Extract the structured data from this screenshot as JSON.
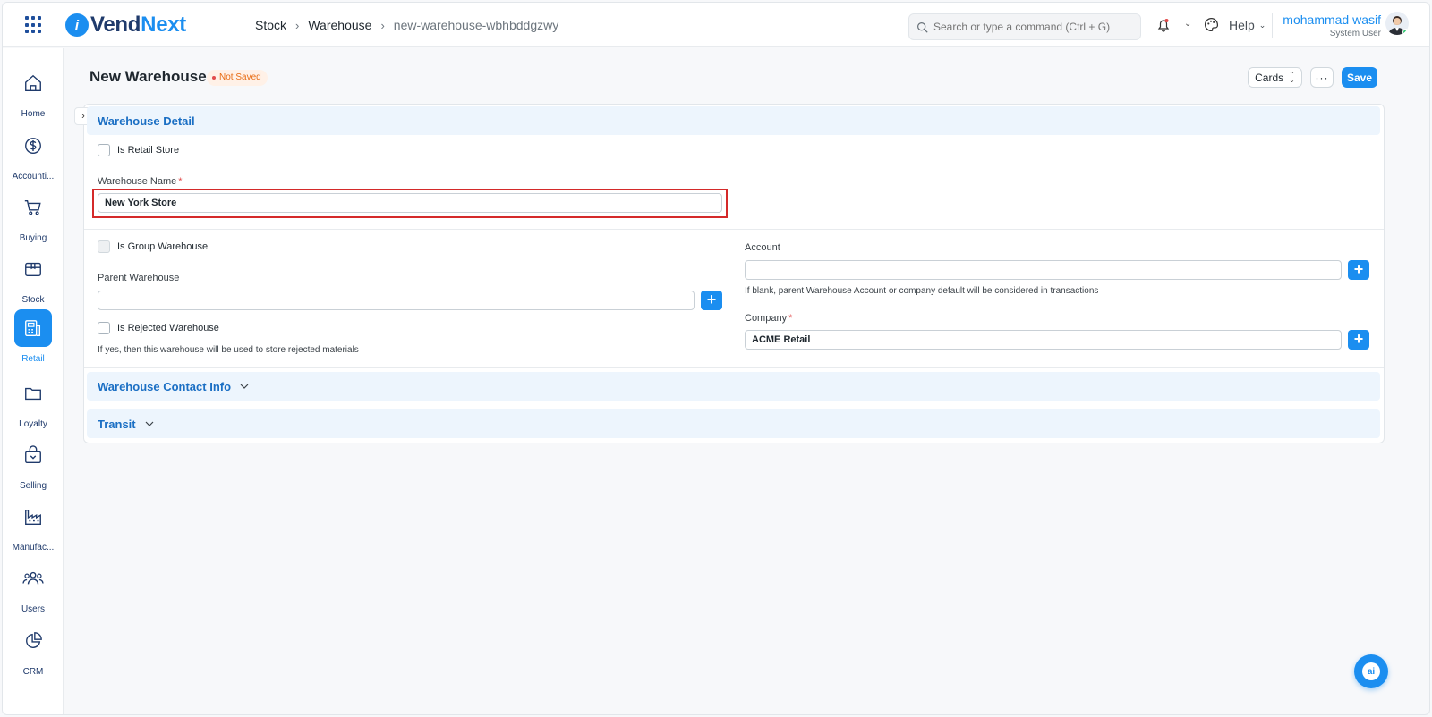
{
  "app": {
    "logo_prefix": "i",
    "logo_brand_a": "Vend",
    "logo_brand_b": "Next"
  },
  "breadcrumb": {
    "items": [
      "Stock",
      "Warehouse",
      "new-warehouse-wbhbddgzwy"
    ]
  },
  "search": {
    "placeholder": "Search or type a command (Ctrl + G)"
  },
  "help": {
    "label": "Help"
  },
  "user": {
    "name": "mohammad wasif",
    "role": "System User"
  },
  "sidebar": {
    "items": [
      {
        "label": "Home",
        "icon": "home-icon",
        "active": false
      },
      {
        "label": "Accounti...",
        "icon": "dollar-icon",
        "active": false
      },
      {
        "label": "Buying",
        "icon": "cart-icon",
        "active": false
      },
      {
        "label": "Stock",
        "icon": "box-icon",
        "active": false
      },
      {
        "label": "Retail",
        "icon": "pos-icon",
        "active": true
      },
      {
        "label": "Loyalty",
        "icon": "folder-icon",
        "active": false
      },
      {
        "label": "Selling",
        "icon": "shopping-bag-icon",
        "active": false
      },
      {
        "label": "Manufac...",
        "icon": "factory-icon",
        "active": false
      },
      {
        "label": "Users",
        "icon": "users-icon",
        "active": false
      },
      {
        "label": "CRM",
        "icon": "pie-chart-icon",
        "active": false
      }
    ]
  },
  "page": {
    "title": "New Warehouse",
    "status": "Not Saved",
    "actions": {
      "view_label": "Cards",
      "more_label": "···",
      "save_label": "Save"
    }
  },
  "form": {
    "sections": {
      "detail": "Warehouse Detail",
      "contact": "Warehouse Contact Info",
      "transit": "Transit"
    },
    "is_retail_store": {
      "label": "Is Retail Store",
      "checked": false
    },
    "warehouse_name": {
      "label": "Warehouse Name",
      "value": "New York Store",
      "required": "*"
    },
    "is_group_warehouse": {
      "label": "Is Group Warehouse",
      "checked": false
    },
    "parent_warehouse": {
      "label": "Parent Warehouse",
      "value": ""
    },
    "is_rejected_warehouse": {
      "label": "Is Rejected Warehouse",
      "checked": false,
      "help": "If yes, then this warehouse will be used to store rejected materials"
    },
    "account": {
      "label": "Account",
      "value": "",
      "help": "If blank, parent Warehouse Account or company default will be considered in transactions"
    },
    "company": {
      "label": "Company",
      "value": "ACME Retail",
      "required": "*"
    }
  },
  "ai_button": {
    "label": "ai"
  },
  "colors": {
    "accent": "#1b8ef0",
    "brand_dark": "#1f3a6b",
    "status_orange": "#e86c13",
    "highlight_red": "#d42a2a"
  }
}
